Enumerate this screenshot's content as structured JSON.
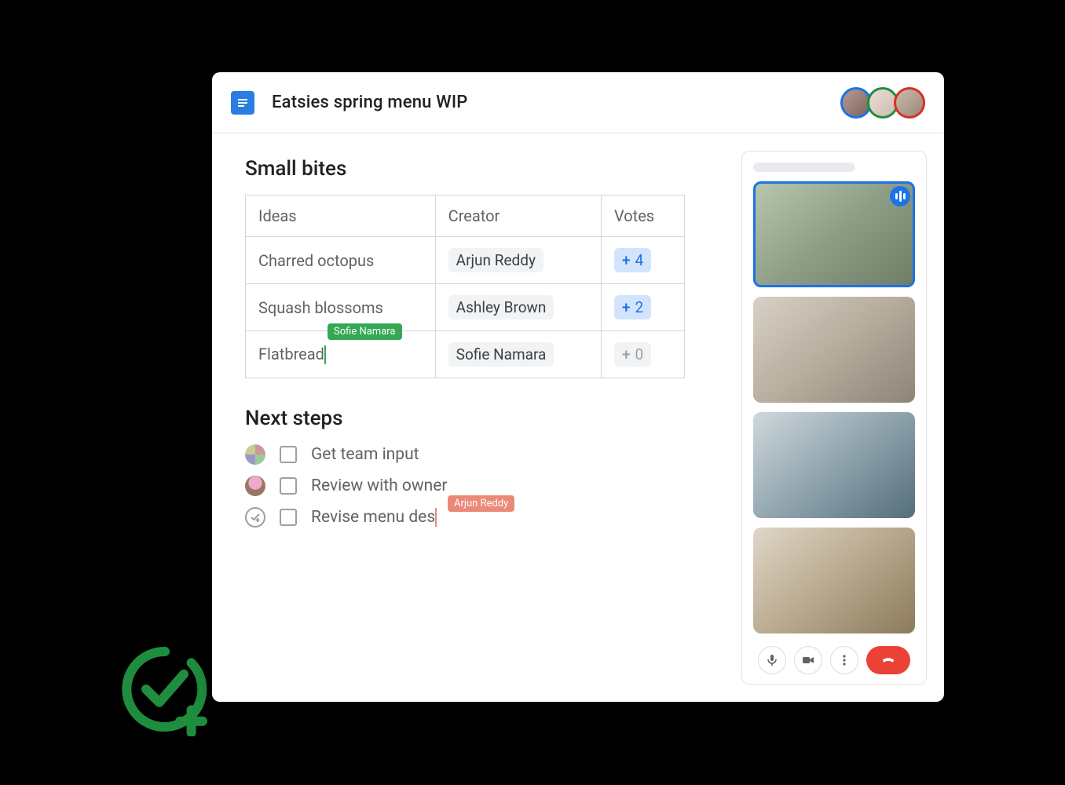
{
  "doc": {
    "title": "Eatsies spring menu WIP"
  },
  "section1": {
    "heading": "Small bites",
    "columns": {
      "ideas": "Ideas",
      "creator": "Creator",
      "votes": "Votes"
    },
    "rows": [
      {
        "idea": "Charred octopus",
        "creator": "Arjun Reddy",
        "votes": "4",
        "positive": true
      },
      {
        "idea": "Squash blossoms",
        "creator": "Ashley Brown",
        "votes": "2",
        "positive": true
      },
      {
        "idea": "Flatbread",
        "creator": "Sofie Namara",
        "votes": "0",
        "positive": false
      }
    ],
    "cursor_label": "Sofie Namara"
  },
  "section2": {
    "heading": "Next steps",
    "items": [
      {
        "text": "Get team input",
        "assignee": "team"
      },
      {
        "text": "Review with owner",
        "assignee": "owner"
      },
      {
        "text": "Revise menu des",
        "assignee": "task",
        "cursor_label": "Arjun Reddy"
      }
    ]
  },
  "meet": {
    "controls": {
      "mic": "mic",
      "camera": "camera",
      "more": "more",
      "hangup": "hangup"
    }
  }
}
